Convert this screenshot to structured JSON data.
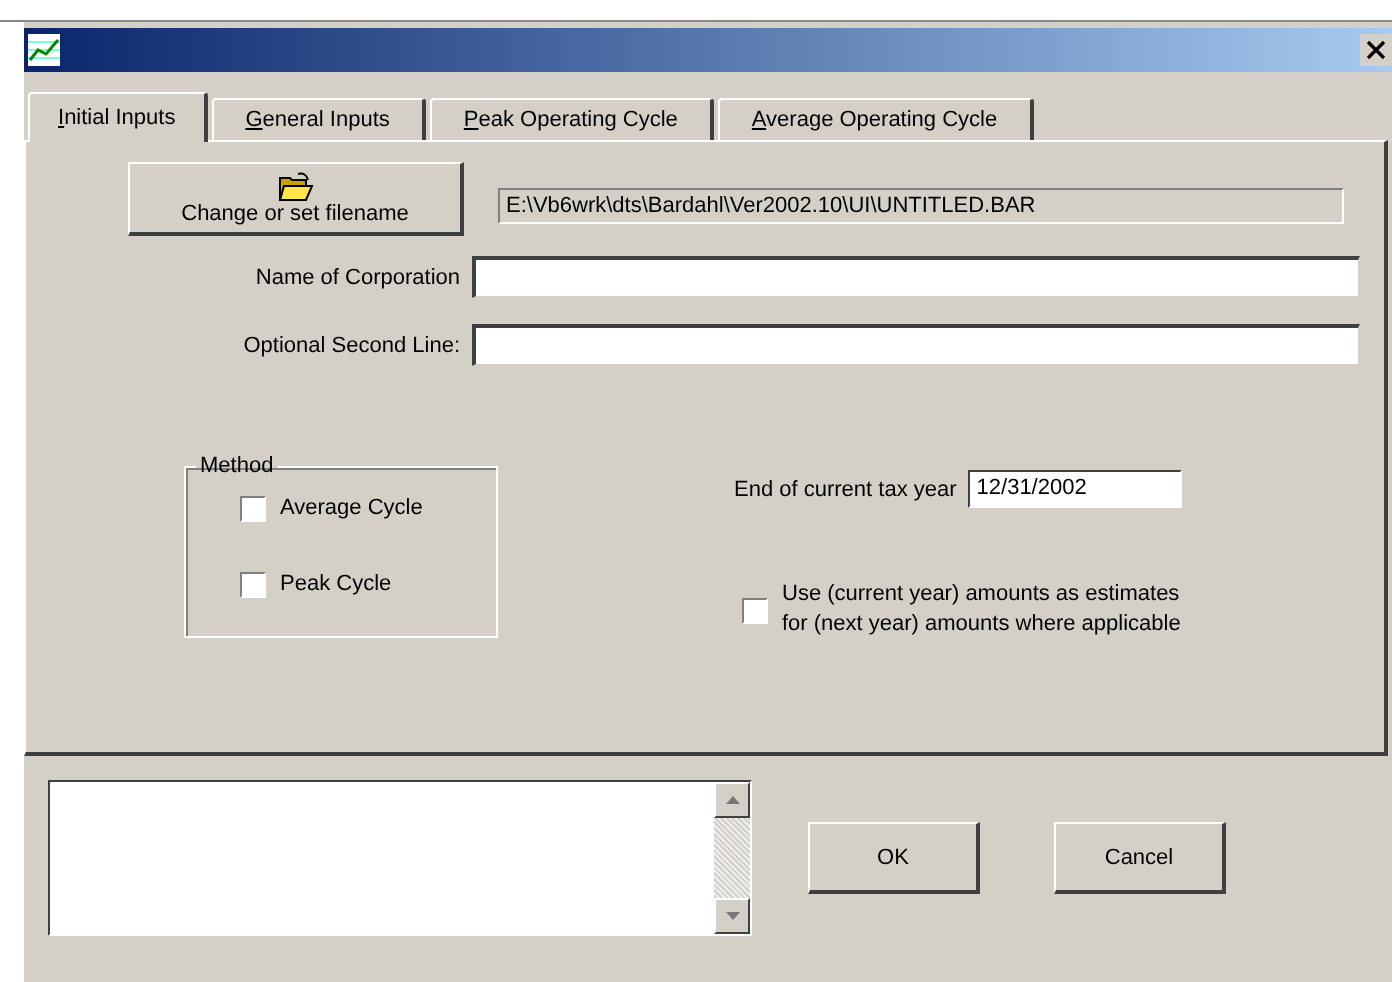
{
  "tabs": [
    {
      "label": "Initial Inputs",
      "selected": true
    },
    {
      "label": "General Inputs",
      "selected": false
    },
    {
      "label": "Peak Operating Cycle",
      "selected": false
    },
    {
      "label": "Average Operating Cycle",
      "selected": false
    }
  ],
  "file_button": "Change or set filename",
  "file_path": "E:\\Vb6wrk\\dts\\Bardahl\\Ver2002.10\\UI\\UNTITLED.BAR",
  "fields": [
    {
      "label": "Name of Corporation"
    },
    {
      "label": "Optional Second Line:"
    }
  ],
  "method": {
    "title": "Method",
    "options": [
      {
        "label": "Average Cycle",
        "checked": false
      },
      {
        "label": "Peak Cycle",
        "checked": false
      }
    ]
  },
  "tax_year": {
    "label": "End of current tax year",
    "value": "12/31/2002"
  },
  "estimates": {
    "label": "Use (current year) amounts as estimates for (next year) amounts where applicable",
    "checked": false
  },
  "buttons": [
    "OK",
    "Cancel"
  ]
}
